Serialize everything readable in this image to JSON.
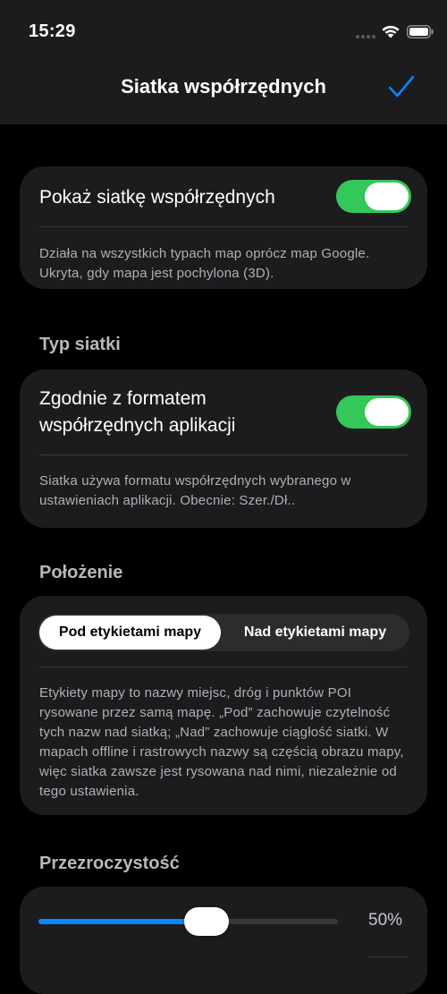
{
  "status_bar": {
    "time": "15:29"
  },
  "nav": {
    "title": "Siatka współrzędnych"
  },
  "show_grid": {
    "label": "Pokaż siatkę współrzędnych",
    "enabled": true,
    "footnote": "Działa na wszystkich typach map oprócz map Google. Ukryta, gdy mapa jest pochylona (3D)."
  },
  "grid_type": {
    "header": "Typ siatki",
    "label_line1": "Zgodnie z formatem",
    "label_line2": "współrzędnych aplikacji",
    "enabled": true,
    "footnote": "Siatka używa formatu współrzędnych wybranego w ustawieniach aplikacji. Obecnie: Szer./Dł.."
  },
  "position": {
    "header": "Położenie",
    "options": [
      "Pod etykietami mapy",
      "Nad etykietami mapy"
    ],
    "selected_index": 0,
    "footnote": "Etykiety mapy to nazwy miejsc, dróg i punktów POI rysowane przez samą mapę. „Pod” zachowuje czytelność tych nazw nad siatką; „Nad” zachowuje ciągłość siatki. W mapach offline i rastrowych nazwy są częścią obrazu mapy, więc siatka zawsze jest rysowana nad nimi, niezależnie od tego ustawienia."
  },
  "opacity": {
    "header": "Przezroczystość",
    "value_fraction": 0.5,
    "value_label": "50%"
  },
  "colors": {
    "accent_blue": "#0a84ff",
    "toggle_green": "#34c759",
    "card_bg": "#1c1c1e"
  }
}
